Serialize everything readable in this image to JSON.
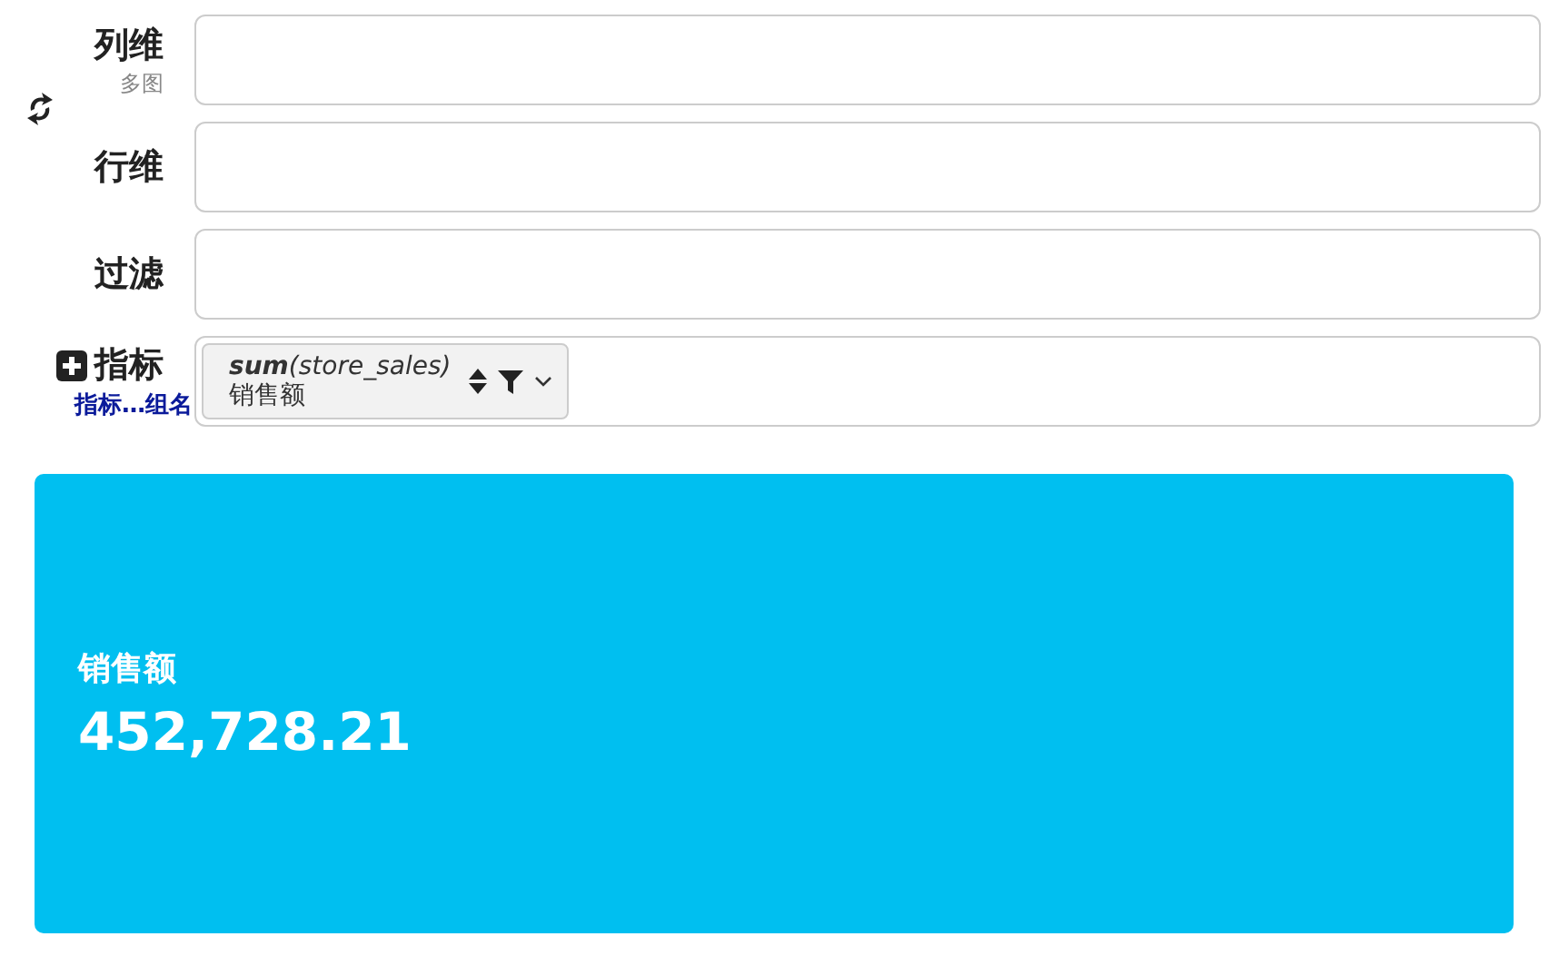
{
  "shelves": [
    {
      "kind": "columns",
      "label": "列维",
      "sublabel": "多图"
    },
    {
      "kind": "rows",
      "label": "行维"
    },
    {
      "kind": "filter",
      "label": "过滤"
    },
    {
      "kind": "measures",
      "label": "指标",
      "link": "指标…组名",
      "pills": [
        {
          "expression": "**sum**(store_sales)",
          "alias": "销售额"
        }
      ]
    }
  ],
  "kpi": {
    "label": "销售额",
    "value": "452,728.21"
  }
}
